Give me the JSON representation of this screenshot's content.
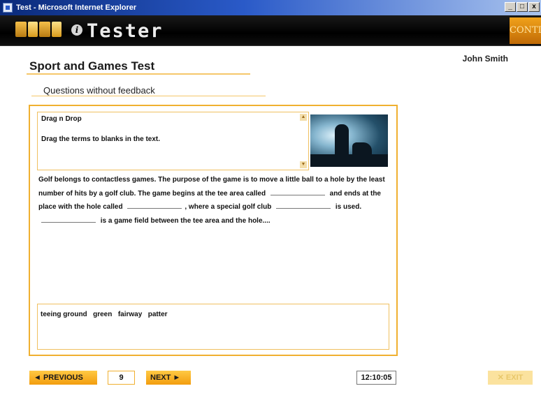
{
  "window": {
    "title": "Test - Microsoft Internet Explorer",
    "controls": {
      "minimize": "_",
      "maximize": "□",
      "close": "x"
    }
  },
  "header": {
    "brand_info_glyph": "i",
    "brand": "Tester",
    "corner_logo": "CONTIS",
    "user_name": "John Smith"
  },
  "test": {
    "title": "Sport and Games Test",
    "subtitle": "Questions without feedback"
  },
  "question": {
    "type_label": "Drag n Drop",
    "instruction": "Drag the terms to blanks in the text.",
    "passage": {
      "part1": "Golf belongs to contactless games. The purpose of the game is to move a little ball to a hole by the least number of hits by a golf club. The game begins at the tee area called",
      "part2": "and ends at the place with the hole called",
      "part3": ", where a special golf club",
      "part4": "is used.",
      "part5": "is a game field between the tee area and the hole...."
    },
    "terms": [
      "teeing ground",
      "green",
      "fairway",
      "patter"
    ]
  },
  "footer": {
    "previous_label": "◄ PREVIOUS",
    "page_number": "9",
    "next_label": "NEXT ►",
    "timer": "12:10:05",
    "exit_label": "✕ EXIT"
  },
  "colors": {
    "accent": "#f0b030",
    "button": "#f5a81c",
    "title_bar": "#0a2a7a"
  }
}
